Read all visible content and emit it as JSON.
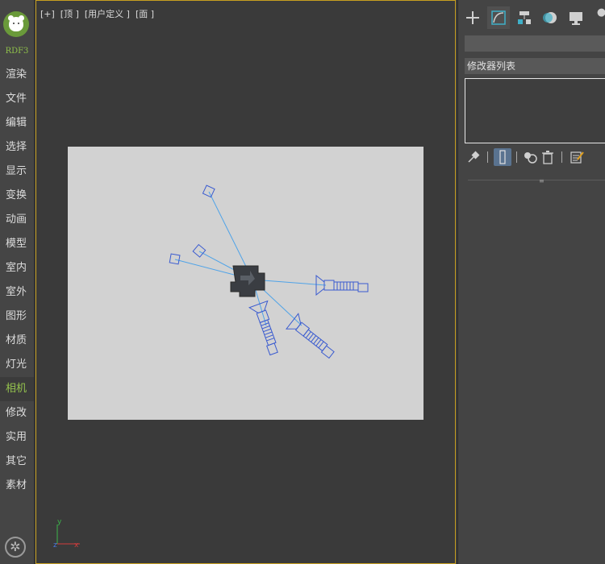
{
  "app": {
    "name": "RDF3"
  },
  "sidebar": {
    "items": [
      {
        "label": "渲染"
      },
      {
        "label": "文件"
      },
      {
        "label": "编辑"
      },
      {
        "label": "选择"
      },
      {
        "label": "显示"
      },
      {
        "label": "变换"
      },
      {
        "label": "动画"
      },
      {
        "label": "模型"
      },
      {
        "label": "室内"
      },
      {
        "label": "室外"
      },
      {
        "label": "图形"
      },
      {
        "label": "材质"
      },
      {
        "label": "灯光"
      },
      {
        "label": "相机",
        "active": true
      },
      {
        "label": "修改"
      },
      {
        "label": "实用"
      },
      {
        "label": "其它"
      },
      {
        "label": "素材"
      }
    ],
    "settings_icon": "gear-icon"
  },
  "viewport": {
    "label": "[+]  [顶 ]  [用户定义 ]  [面 ]",
    "axis": {
      "x": "x",
      "y": "y",
      "z": "z"
    }
  },
  "command_panel": {
    "tabs": [
      {
        "icon": "plus-icon",
        "name": "create"
      },
      {
        "icon": "curve-icon",
        "name": "modify"
      },
      {
        "icon": "hierarchy-icon",
        "name": "hierarchy"
      },
      {
        "icon": "motion-icon",
        "name": "motion"
      },
      {
        "icon": "display-icon",
        "name": "display"
      },
      {
        "icon": "wrench-icon",
        "name": "utilities"
      }
    ],
    "name_field": "",
    "modifier_list_label": "修改器列表",
    "stack_tools": [
      "pin-icon",
      "show-end-result-icon",
      "make-unique-icon",
      "trash-icon",
      "configure-icon"
    ]
  },
  "colors": {
    "accent_green": "#94c24d",
    "viewport_border": "#c8a020",
    "camera_wire": "#3a5bd0",
    "target_line": "#4fa3e8"
  }
}
